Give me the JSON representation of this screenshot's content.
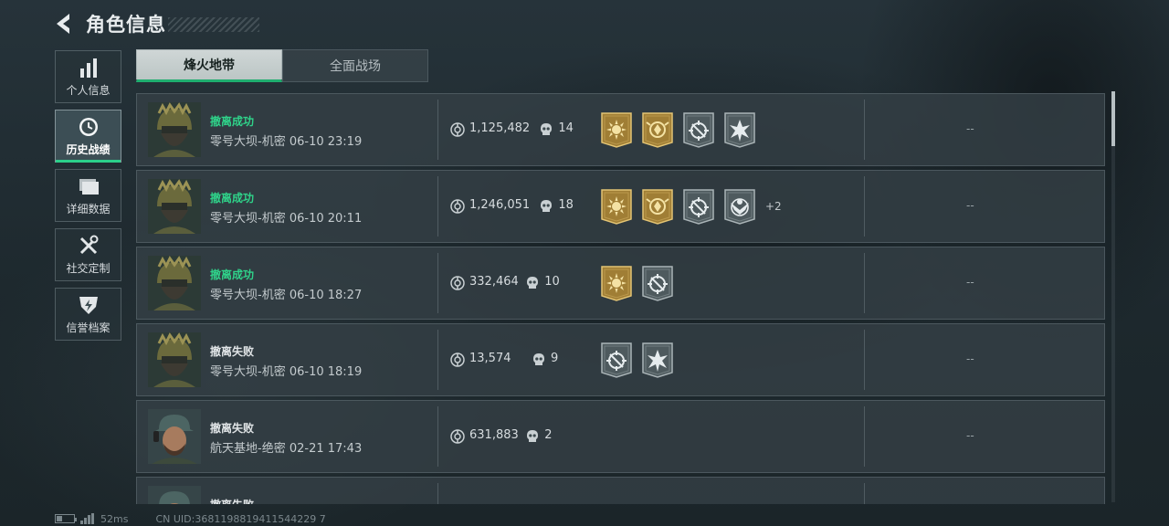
{
  "header": {
    "title": "角色信息"
  },
  "sidebar": {
    "items": [
      {
        "label": "个人信息",
        "icon": "bar-chart-icon",
        "active": false
      },
      {
        "label": "历史战绩",
        "icon": "clock-icon",
        "active": true
      },
      {
        "label": "详细数据",
        "icon": "folder-icon",
        "active": false
      },
      {
        "label": "社交定制",
        "icon": "tools-icon",
        "active": false
      },
      {
        "label": "信誉档案",
        "icon": "shield-bolt-icon",
        "active": false
      }
    ]
  },
  "tabs": [
    {
      "label": "烽火地带",
      "active": true
    },
    {
      "label": "全面战场",
      "active": false
    }
  ],
  "records": [
    {
      "status": "撤离成功",
      "success": true,
      "map": "零号大坝-机密",
      "time": "06-10 23:19",
      "money": "1,125,482",
      "kills": "14",
      "badges": [
        "gold-sun",
        "gold-emblem",
        "grey-target",
        "grey-star"
      ],
      "extra": "",
      "rating": "--",
      "avatar": "helmet"
    },
    {
      "status": "撤离成功",
      "success": true,
      "map": "零号大坝-机密",
      "time": "06-10 20:11",
      "money": "1,246,051",
      "kills": "18",
      "badges": [
        "gold-sun",
        "gold-emblem",
        "grey-target",
        "grey-eagle"
      ],
      "extra": "+2",
      "rating": "--",
      "avatar": "helmet"
    },
    {
      "status": "撤离成功",
      "success": true,
      "map": "零号大坝-机密",
      "time": "06-10 18:27",
      "money": "332,464",
      "kills": "10",
      "badges": [
        "gold-sun",
        "grey-target"
      ],
      "extra": "",
      "rating": "--",
      "avatar": "helmet"
    },
    {
      "status": "撤离失败",
      "success": false,
      "map": "零号大坝-机密",
      "time": "06-10 18:19",
      "money": "13,574",
      "kills": "9",
      "badges": [
        "grey-target",
        "grey-star"
      ],
      "extra": "",
      "rating": "--",
      "avatar": "helmet"
    },
    {
      "status": "撤离失败",
      "success": false,
      "map": "航天基地-绝密",
      "time": "02-21 17:43",
      "money": "631,883",
      "kills": "2",
      "badges": [],
      "extra": "",
      "rating": "--",
      "avatar": "cap"
    },
    {
      "status": "撤离失败",
      "success": false,
      "map": "",
      "time": "",
      "money": "",
      "kills": "",
      "badges": [],
      "extra": "",
      "rating": "",
      "avatar": "cap"
    }
  ],
  "footer": {
    "latency": "52ms",
    "uid": "CN UID:3681198819411544229 7"
  },
  "colors": {
    "success": "#2fd38a",
    "accent": "#1fae6f",
    "gold": "#c9a24a"
  }
}
